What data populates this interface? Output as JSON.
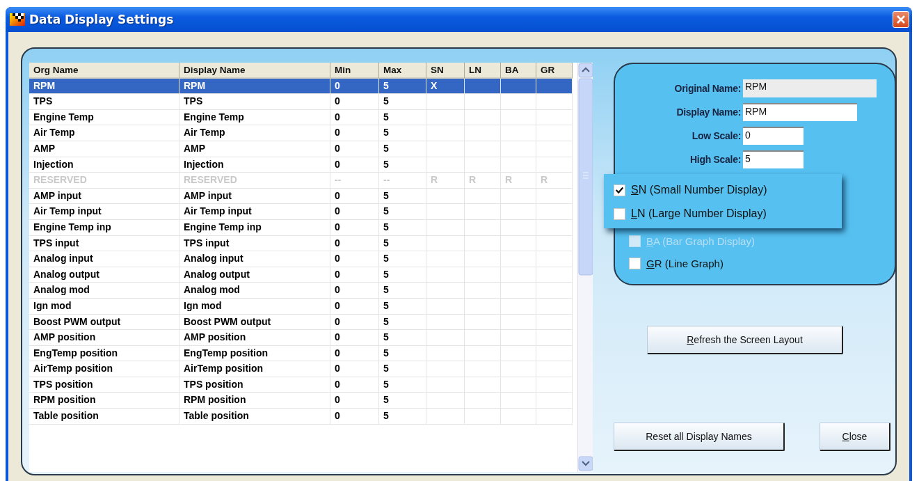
{
  "window": {
    "title": "Data Display Settings"
  },
  "table": {
    "columns": [
      "Org Name",
      "Display Name",
      "Min",
      "Max",
      "SN",
      "LN",
      "BA",
      "GR"
    ],
    "rows": [
      {
        "org_name": "RPM",
        "display_name": "RPM",
        "min": "0",
        "max": "5",
        "sn": "X",
        "selected": true,
        "disabled": false
      },
      {
        "org_name": "TPS",
        "display_name": "TPS",
        "min": "0",
        "max": "5",
        "selected": false,
        "disabled": false
      },
      {
        "org_name": "Engine Temp",
        "display_name": "Engine Temp",
        "min": "0",
        "max": "5",
        "selected": false,
        "disabled": false
      },
      {
        "org_name": "Air Temp",
        "display_name": "Air Temp",
        "min": "0",
        "max": "5",
        "selected": false,
        "disabled": false
      },
      {
        "org_name": "AMP",
        "display_name": "AMP",
        "min": "0",
        "max": "5",
        "selected": false,
        "disabled": false
      },
      {
        "org_name": "Injection",
        "display_name": "Injection",
        "min": "0",
        "max": "5",
        "selected": false,
        "disabled": false
      },
      {
        "org_name": "RESERVED",
        "display_name": "RESERVED",
        "min": "--",
        "max": "--",
        "sn": "R",
        "ln": "R",
        "ba": "R",
        "gr": "R",
        "selected": false,
        "disabled": true
      },
      {
        "org_name": "AMP input",
        "display_name": "AMP input",
        "min": "0",
        "max": "5",
        "selected": false,
        "disabled": false
      },
      {
        "org_name": "Air Temp input",
        "display_name": "Air Temp input",
        "min": "0",
        "max": "5",
        "selected": false,
        "disabled": false
      },
      {
        "org_name": "Engine Temp inp",
        "display_name": "Engine Temp inp",
        "min": "0",
        "max": "5",
        "selected": false,
        "disabled": false
      },
      {
        "org_name": "TPS input",
        "display_name": "TPS input",
        "min": "0",
        "max": "5",
        "selected": false,
        "disabled": false
      },
      {
        "org_name": "Analog input",
        "display_name": "Analog input",
        "min": "0",
        "max": "5",
        "selected": false,
        "disabled": false
      },
      {
        "org_name": "Analog output",
        "display_name": "Analog output",
        "min": "0",
        "max": "5",
        "selected": false,
        "disabled": false
      },
      {
        "org_name": "Analog mod",
        "display_name": "Analog mod",
        "min": "0",
        "max": "5",
        "selected": false,
        "disabled": false
      },
      {
        "org_name": "Ign mod",
        "display_name": "Ign mod",
        "min": "0",
        "max": "5",
        "selected": false,
        "disabled": false
      },
      {
        "org_name": "Boost PWM output",
        "display_name": "Boost PWM output",
        "min": "0",
        "max": "5",
        "selected": false,
        "disabled": false
      },
      {
        "org_name": "AMP position",
        "display_name": "AMP position",
        "min": "0",
        "max": "5",
        "selected": false,
        "disabled": false
      },
      {
        "org_name": "EngTemp position",
        "display_name": "EngTemp position",
        "min": "0",
        "max": "5",
        "selected": false,
        "disabled": false
      },
      {
        "org_name": "AirTemp position",
        "display_name": "AirTemp position",
        "min": "0",
        "max": "5",
        "selected": false,
        "disabled": false
      },
      {
        "org_name": "TPS position",
        "display_name": "TPS position",
        "min": "0",
        "max": "5",
        "selected": false,
        "disabled": false
      },
      {
        "org_name": "RPM position",
        "display_name": "RPM position",
        "min": "0",
        "max": "5",
        "selected": false,
        "disabled": false
      },
      {
        "org_name": "Table position",
        "display_name": "Table position",
        "min": "0",
        "max": "5",
        "selected": false,
        "disabled": false
      }
    ]
  },
  "details": {
    "fields": [
      {
        "label": "Original Name:",
        "value": "RPM",
        "readonly": true
      },
      {
        "label": "Display Name:",
        "value": "RPM",
        "readonly": false
      },
      {
        "label": "Low Scale:",
        "value": "0",
        "readonly": false
      },
      {
        "label": "High Scale:",
        "value": "5",
        "readonly": false
      }
    ],
    "options": [
      {
        "label": "SN (Small Number Display)",
        "checked": true,
        "disabled": false,
        "highlighted": true,
        "mnemonic": true
      },
      {
        "label": "LN (Large Number Display)",
        "checked": false,
        "disabled": false,
        "highlighted": true,
        "mnemonic": true
      },
      {
        "label": "BA (Bar Graph Display)",
        "checked": false,
        "disabled": true,
        "highlighted": false,
        "mnemonic": true
      },
      {
        "label": "GR (Line Graph)",
        "checked": false,
        "disabled": false,
        "highlighted": false,
        "mnemonic": true
      }
    ]
  },
  "buttons": [
    {
      "label": "Refresh the Screen Layout",
      "mnemonic": true
    },
    {
      "label": "Reset all Display Names",
      "mnemonic": false
    },
    {
      "label": "Close",
      "mnemonic": true
    }
  ]
}
